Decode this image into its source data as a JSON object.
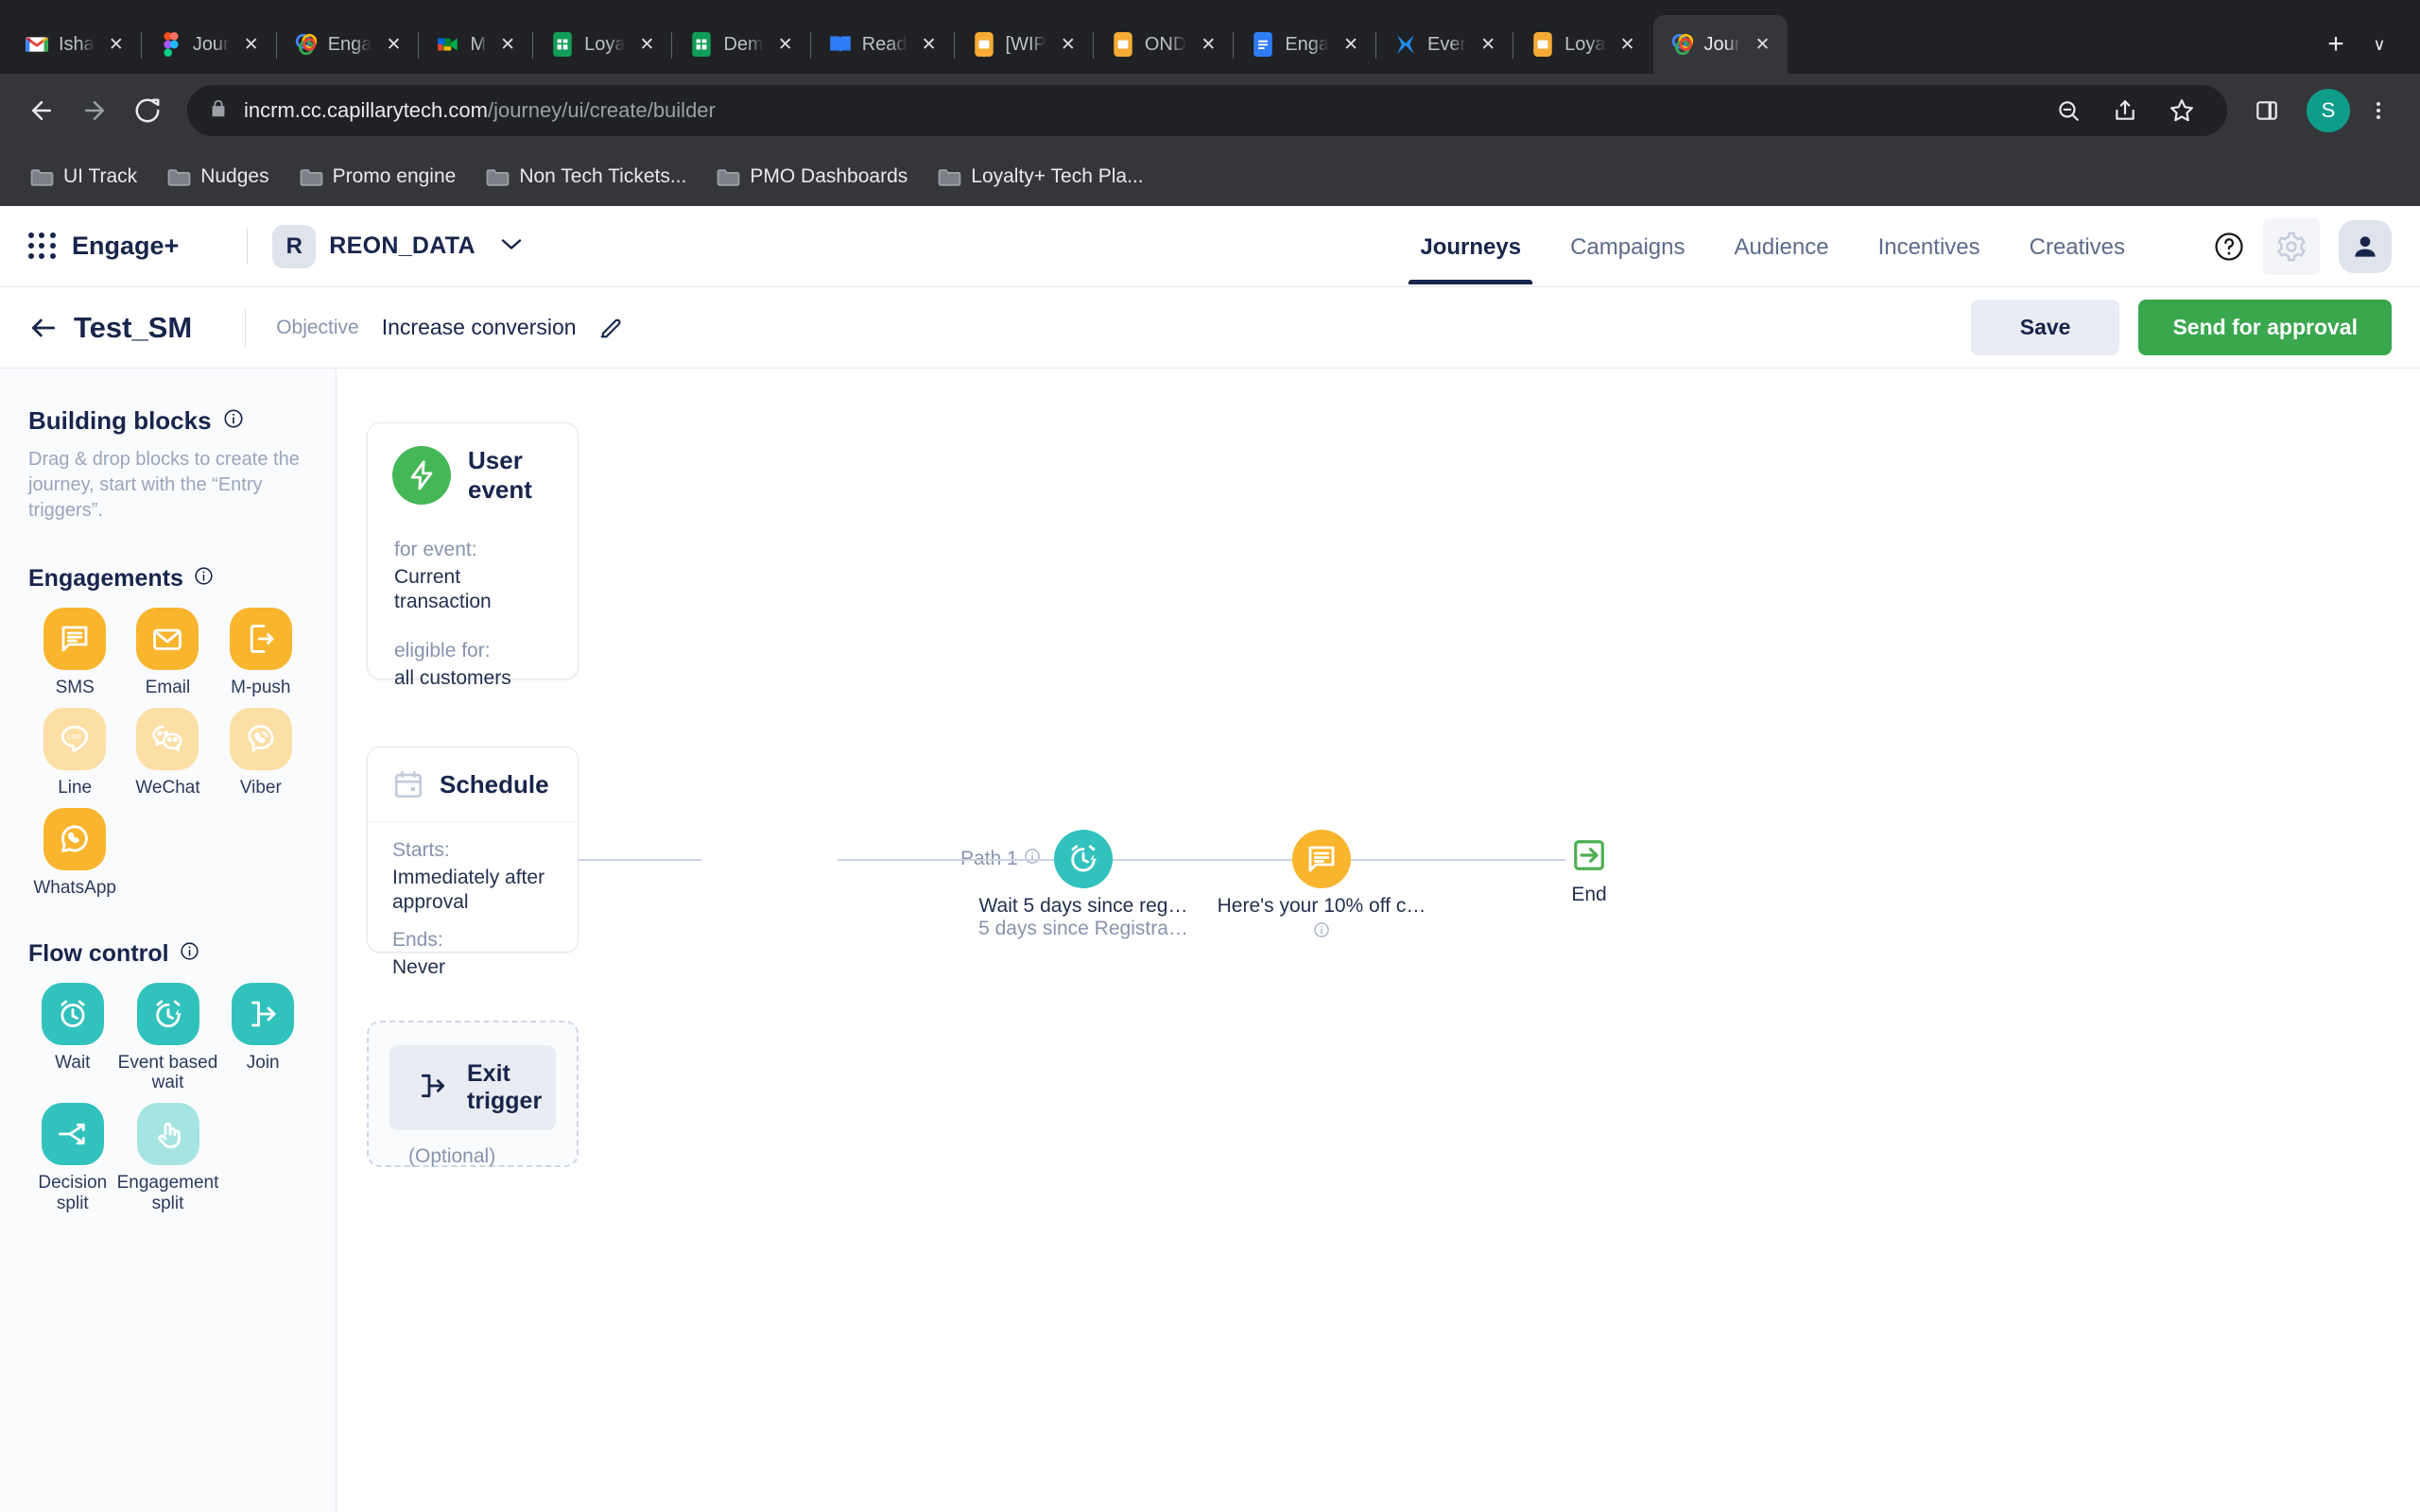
{
  "browser": {
    "tabs": [
      {
        "title": "Isha",
        "icon": "gmail-icon",
        "fav_color": "#ffffff",
        "fav_text": "M",
        "active": false
      },
      {
        "title": "Jour",
        "icon": "figma-icon",
        "fav_color": "#ffffff",
        "fav_text": "F",
        "active": false
      },
      {
        "title": "Enga",
        "icon": "capillary-icon",
        "fav_color": "#ffffff",
        "fav_text": "C",
        "active": false
      },
      {
        "title": "M",
        "icon": "google-meet-icon",
        "fav_color": "#ffffff",
        "fav_text": "G",
        "active": false
      },
      {
        "title": "Loya",
        "icon": "google-sheets-icon",
        "fav_color": "#1e9e62",
        "fav_text": "S",
        "active": false
      },
      {
        "title": "Dem",
        "icon": "google-sheets-icon",
        "fav_color": "#1e9e62",
        "fav_text": "S",
        "active": false
      },
      {
        "title": "Read",
        "icon": "readme-icon",
        "fav_color": "#2e7df6",
        "fav_text": "R",
        "active": false
      },
      {
        "title": "[WIP",
        "icon": "jira-board-icon",
        "fav_color": "#f5b335",
        "fav_text": " ",
        "active": false
      },
      {
        "title": "OND",
        "icon": "jira-board-icon",
        "fav_color": "#f5b335",
        "fav_text": " ",
        "active": false
      },
      {
        "title": "Enga",
        "icon": "google-docs-icon",
        "fav_color": "#2e7df6",
        "fav_text": "D",
        "active": false
      },
      {
        "title": "Ever",
        "icon": "everhour-icon",
        "fav_color": "#ffffff",
        "fav_text": "E",
        "active": false
      },
      {
        "title": "Loya",
        "icon": "jira-board-icon",
        "fav_color": "#f5b335",
        "fav_text": " ",
        "active": false
      },
      {
        "title": "Jour",
        "icon": "capillary-icon",
        "fav_color": "#ffffff",
        "fav_text": "C",
        "active": true
      }
    ],
    "new_tab_label": "+",
    "tab_list_label": "∨",
    "nav": {
      "back": "back-icon",
      "forward": "forward-icon",
      "reload": "reload-icon"
    },
    "omnibox": {
      "lock": "lock-icon",
      "domain": "incrm.cc.capillarytech.com",
      "path": "/journey/ui/create/builder",
      "zoom_out_icon": "zoom-out-icon",
      "share_icon": "share-icon",
      "bookmark_icon": "star-icon"
    },
    "side_panel_icon": "side-panel-icon",
    "profile_initial": "S",
    "menu_icon": "three-dots-icon",
    "bookmarks": [
      {
        "label": "UI Track"
      },
      {
        "label": "Nudges"
      },
      {
        "label": "Promo engine"
      },
      {
        "label": "Non Tech Tickets..."
      },
      {
        "label": "PMO Dashboards"
      },
      {
        "label": "Loyalty+ Tech Pla..."
      }
    ]
  },
  "app": {
    "brand": "Engage+",
    "account": {
      "badge": "R",
      "name": "REON_DATA"
    },
    "nav_tabs": [
      {
        "label": "Journeys",
        "active": true
      },
      {
        "label": "Campaigns",
        "active": false
      },
      {
        "label": "Audience",
        "active": false
      },
      {
        "label": "Incentives",
        "active": false
      },
      {
        "label": "Creatives",
        "active": false
      }
    ],
    "help_icon": "help-circle-icon",
    "settings_icon": "gear-icon",
    "avatar_icon": "user-avatar-icon"
  },
  "subbar": {
    "back_icon": "back-arrow-icon",
    "journey_title": "Test_SM",
    "objective_label": "Objective",
    "objective_value": "Increase conversion",
    "edit_icon": "pencil-icon",
    "save_label": "Save",
    "send_label": "Send for approval"
  },
  "sidebar": {
    "title": "Building blocks",
    "title_info_icon": "info-icon",
    "description": "Drag & drop blocks to create the journey, start with the “Entry triggers”.",
    "engagements": {
      "heading": "Engagements",
      "info_icon": "info-icon",
      "items": [
        {
          "label": "SMS",
          "icon": "sms-icon",
          "color": "#f9b52e",
          "enabled": true
        },
        {
          "label": "Email",
          "icon": "email-icon",
          "color": "#f9b52e",
          "enabled": true
        },
        {
          "label": "M-push",
          "icon": "mobile-push-icon",
          "color": "#f9b52e",
          "enabled": true
        },
        {
          "label": "Line",
          "icon": "line-icon",
          "color": "#fbdfa4",
          "enabled": false
        },
        {
          "label": "WeChat",
          "icon": "wechat-icon",
          "color": "#fbdfa4",
          "enabled": false
        },
        {
          "label": "Viber",
          "icon": "viber-icon",
          "color": "#fbdfa4",
          "enabled": false
        },
        {
          "label": "WhatsApp",
          "icon": "whatsapp-icon",
          "color": "#f9b52e",
          "enabled": true
        }
      ]
    },
    "flow_control": {
      "heading": "Flow control",
      "info_icon": "info-icon",
      "items": [
        {
          "label": "Wait",
          "icon": "alarm-clock-icon",
          "color": "#32c2be",
          "enabled": true
        },
        {
          "label": "Event based wait",
          "icon": "event-wait-icon",
          "color": "#32c2be",
          "enabled": true
        },
        {
          "label": "Join",
          "icon": "join-icon",
          "color": "#32c2be",
          "enabled": true
        },
        {
          "label": "Decision split",
          "icon": "decision-split-icon",
          "color": "#32c2be",
          "enabled": true
        },
        {
          "label": "Engagement split",
          "icon": "engagement-split-icon",
          "color": "#a6e4e2",
          "enabled": false
        }
      ]
    }
  },
  "canvas": {
    "entry_card": {
      "icon": "lightning-bolt-icon",
      "icon_color": "#44b757",
      "title": "User event",
      "fields": [
        {
          "label": "for event:",
          "value": "Current transaction"
        },
        {
          "label": "eligible for:",
          "value": "all customers"
        }
      ]
    },
    "schedule_card": {
      "icon": "calendar-icon",
      "title": "Schedule",
      "fields": [
        {
          "label": "Starts:",
          "value": "Immediately after approval"
        },
        {
          "label": "Ends:",
          "value": "Never"
        }
      ]
    },
    "exit_card": {
      "icon": "exit-trigger-icon",
      "label": "Exit trigger",
      "optional": "(Optional)"
    },
    "path_label": "Path 1",
    "path_info_icon": "info-icon",
    "flow_nodes": [
      {
        "icon": "event-wait-icon",
        "icon_color": "#32c2be",
        "line1": "Wait 5 days since reg…",
        "line2": "5 days since Registra…",
        "info_icon": null
      },
      {
        "icon": "sms-icon",
        "icon_color": "#f9b52e",
        "line1": "Here's your 10% off c…",
        "line2": "",
        "info_icon": "info-icon"
      }
    ],
    "end_node": {
      "icon": "end-arrow-icon",
      "label": "End",
      "color": "#4caf50"
    }
  },
  "colors": {
    "brand_navy": "#18254b",
    "accent_green": "#3aa74e",
    "engagement_yellow": "#f9b52e",
    "flow_teal": "#32c2be",
    "muted_text": "#8894ae"
  }
}
